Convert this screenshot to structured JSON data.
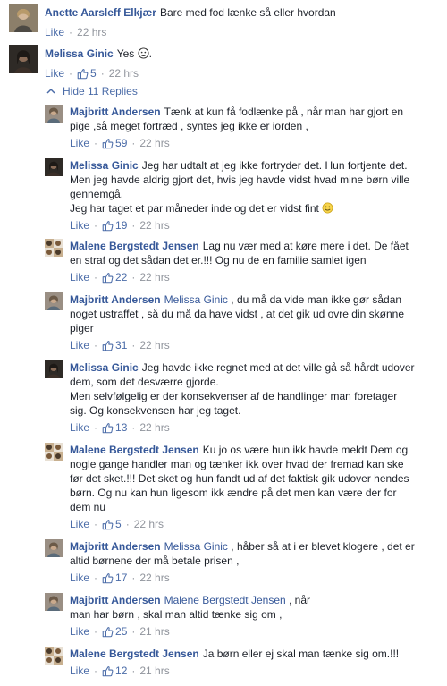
{
  "comments": [
    {
      "author": "Anette Aarsleff Elkjær",
      "text": "Bare med fod lænke så eller hvordan",
      "like_label": "Like",
      "time": "22 hrs"
    },
    {
      "author": "Melissa Ginic",
      "text": "Yes",
      "like_label": "Like",
      "likes": "5",
      "time": "22 hrs"
    }
  ],
  "hide_replies_label": "Hide 11 Replies",
  "replies": [
    {
      "author": "Majbritt Andersen",
      "line1": "Tænk at kun få fodlænke på , når man har gjort en",
      "line2": "pige ,så meget fortræd , syntes jeg ikke er iorden ,",
      "like_label": "Like",
      "likes": "59",
      "time": "22 hrs"
    },
    {
      "author": "Melissa Ginic",
      "line1": "Jeg har udtalt at jeg ikke fortryder det. Hun fortjente det.",
      "line2": "Men jeg havde aldrig gjort det, hvis jeg havde vidst hvad mine børn ville",
      "line3": "gennemgå.",
      "line4": "Jeg har taget et par måneder inde og det er vidst fint",
      "like_label": "Like",
      "likes": "19",
      "time": "22 hrs"
    },
    {
      "author": "Malene Bergstedt Jensen",
      "line1": "Lag nu vær med at køre mere i det. De fået",
      "line2": "en straf og det sådan det er.!!! Og nu de en familie samlet igen",
      "like_label": "Like",
      "likes": "22",
      "time": "22 hrs"
    },
    {
      "author": "Majbritt Andersen",
      "mention": "Melissa Ginic",
      "line1": ", du må da vide man ikke gør sådan",
      "line2": "noget ustraffet , så du må da have vidst , at det gik ud ovre din skønne",
      "line3": "piger",
      "like_label": "Like",
      "likes": "31",
      "time": "22 hrs"
    },
    {
      "author": "Melissa Ginic",
      "line1": "Jeg havde ikke regnet med at det ville gå så hårdt udover",
      "line2": "dem, som det desværre gjorde.",
      "line3": "Men selvfølgelig er der konsekvenser af de handlinger man foretager",
      "line4": "sig. Og konsekvensen har jeg taget.",
      "like_label": "Like",
      "likes": "13",
      "time": "22 hrs"
    },
    {
      "author": "Malene Bergstedt Jensen",
      "line1": "Ku jo os være hun ikk havde meldt Dem og",
      "line2": "nogle gange handler man og tænker ikk over hvad der fremad kan ske",
      "line3": "før det sket.!!! Det sket og hun fandt ud af det faktisk gik udover hendes",
      "line4": "børn. Og nu kan hun ligesom ikk ændre på det men kan være der for",
      "line5": "dem nu",
      "like_label": "Like",
      "likes": "5",
      "time": "22 hrs"
    },
    {
      "author": "Majbritt Andersen",
      "mention": "Melissa Ginic",
      "line1": ", håber så at i er blevet klogere , det er",
      "line2": "altid børnene der må betale prisen ,",
      "like_label": "Like",
      "likes": "17",
      "time": "22 hrs"
    },
    {
      "author": "Majbritt Andersen",
      "mention": "Malene Bergstedt Jensen",
      "line1": ", når",
      "line2": "man har børn , skal man altid tænke sig om ,",
      "like_label": "Like",
      "likes": "25",
      "time": "21 hrs"
    },
    {
      "author": "Malene Bergstedt Jensen",
      "line1": "Ja børn eller ej skal man tænke sig om.!!!",
      "like_label": "Like",
      "likes": "12",
      "time": "21 hrs"
    }
  ]
}
